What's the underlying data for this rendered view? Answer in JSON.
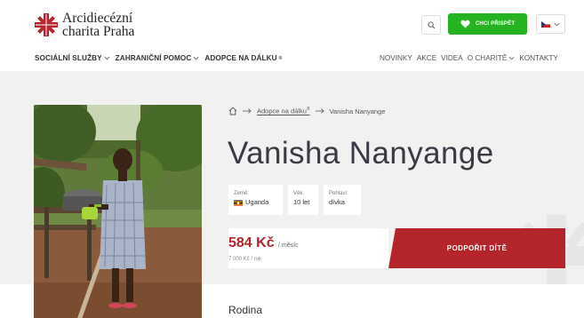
{
  "brand": {
    "line1": "Arcidiecézní",
    "line2": "charita Praha",
    "color": "#b3242b"
  },
  "header": {
    "search_icon": "search-icon",
    "donate_label": "CHCI PŘISPĚT",
    "donate_color": "#25b321",
    "language_icon": "czech-flag-icon"
  },
  "nav_main": [
    {
      "label": "SOCIÁLNÍ SLUŽBY",
      "has_dropdown": true
    },
    {
      "label": "ZAHRANIČNÍ POMOC",
      "has_dropdown": true
    },
    {
      "label": "ADOPCE NA DÁLKU",
      "sup": "®",
      "has_dropdown": false
    }
  ],
  "nav_secondary": [
    {
      "label": "NOVINKY"
    },
    {
      "label": "AKCE"
    },
    {
      "label": "VIDEA"
    },
    {
      "label": "O CHARITĚ",
      "has_dropdown": true
    },
    {
      "label": "KONTAKTY"
    }
  ],
  "breadcrumb": {
    "home_icon": "home-icon",
    "link": "Adopce na dálku",
    "link_sup": "®",
    "current": "Vanisha Nanyange"
  },
  "child": {
    "name": "Vanisha Nanyange",
    "country_label": "Země:",
    "country": "Uganda",
    "age_label": "Věk:",
    "age": "10 let",
    "gender_label": "Pohlaví:",
    "gender": "dívka"
  },
  "price": {
    "amount": "584 Kč",
    "unit": "/ měsíc",
    "yearly": "7 000 Kč / rok"
  },
  "support_button": "PODPOŘIT DÍTĚ",
  "section_heading": "Rodina"
}
